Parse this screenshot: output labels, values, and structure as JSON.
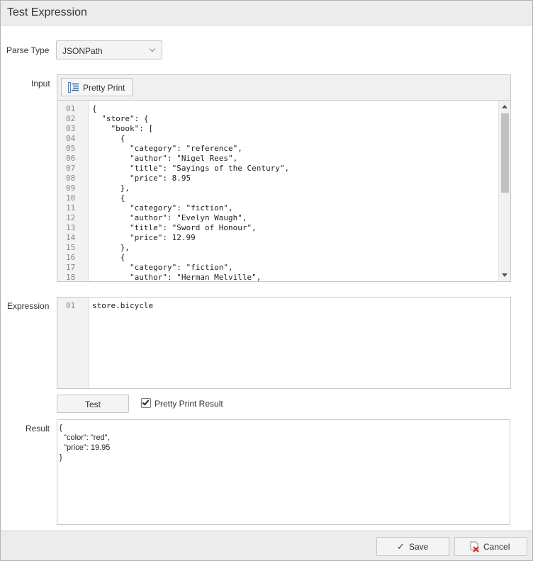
{
  "dialog": {
    "title": "Test Expression"
  },
  "parse_type": {
    "label": "Parse Type",
    "selected": "JSONPath"
  },
  "input": {
    "label": "Input",
    "pretty_print_label": "Pretty Print",
    "line_numbers": [
      "01",
      "02",
      "03",
      "04",
      "05",
      "06",
      "07",
      "08",
      "09",
      "10",
      "11",
      "12",
      "13",
      "14",
      "15",
      "16",
      "17",
      "18"
    ],
    "lines": [
      "{",
      "  \"store\": {",
      "    \"book\": [",
      "      {",
      "        \"category\": \"reference\",",
      "        \"author\": \"Nigel Rees\",",
      "        \"title\": \"Sayings of the Century\",",
      "        \"price\": 8.95",
      "      },",
      "      {",
      "        \"category\": \"fiction\",",
      "        \"author\": \"Evelyn Waugh\",",
      "        \"title\": \"Sword of Honour\",",
      "        \"price\": 12.99",
      "      },",
      "      {",
      "        \"category\": \"fiction\",",
      "        \"author\": \"Herman Melville\","
    ]
  },
  "expression": {
    "label": "Expression",
    "line_numbers": [
      "01"
    ],
    "lines": [
      "store.bicycle"
    ]
  },
  "actions": {
    "test_label": "Test",
    "pretty_print_result_label": "Pretty Print Result",
    "pretty_print_result_checked": true
  },
  "result": {
    "label": "Result",
    "lines": [
      "{",
      "  \"color\": \"red\",",
      "  \"price\": 19.95",
      "}"
    ]
  },
  "footer": {
    "save_label": "Save",
    "cancel_label": "Cancel"
  }
}
